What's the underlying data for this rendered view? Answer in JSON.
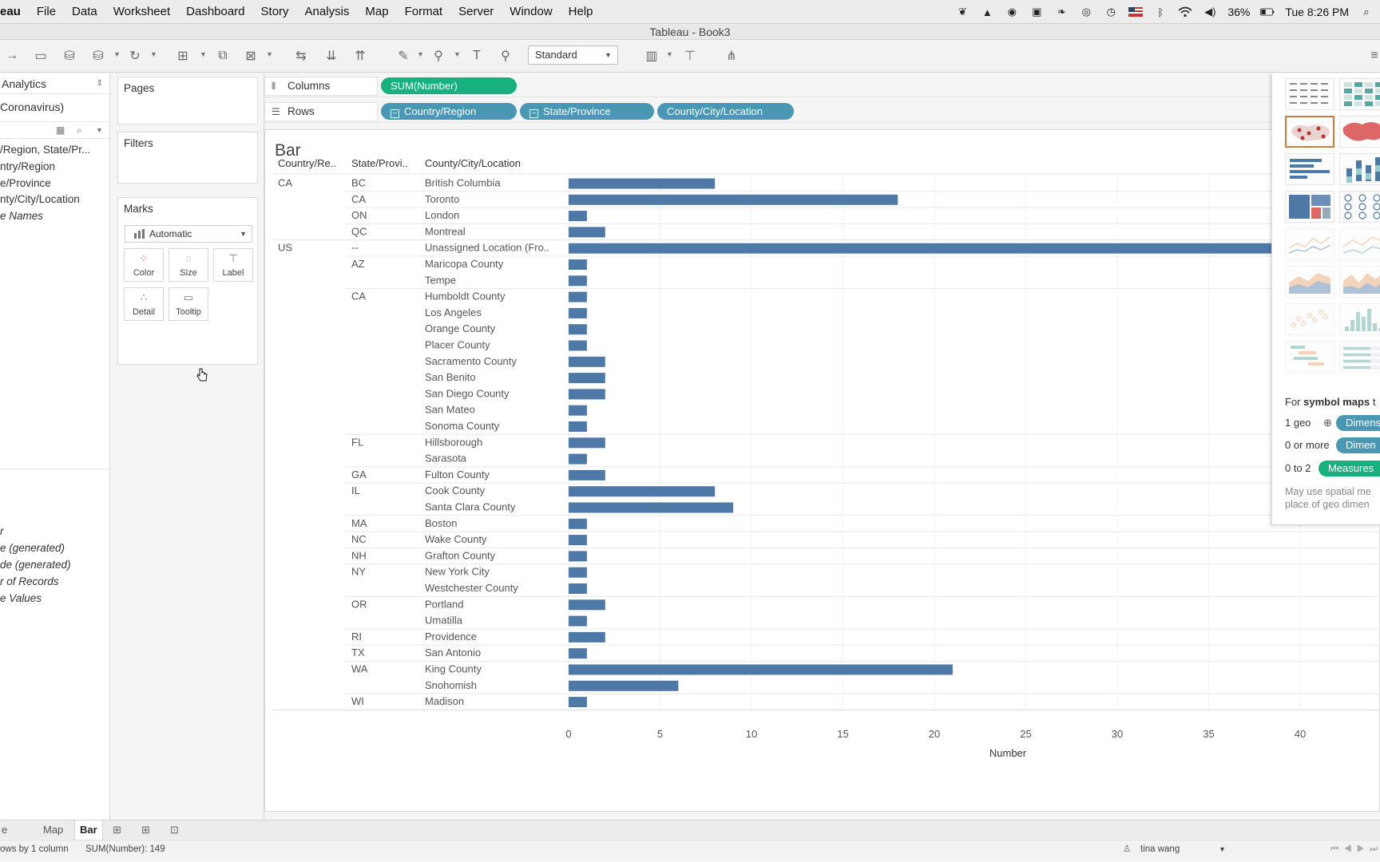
{
  "menubar": {
    "app_name": "eau",
    "items": [
      "File",
      "Data",
      "Worksheet",
      "Dashboard",
      "Story",
      "Analysis",
      "Map",
      "Format",
      "Server",
      "Window",
      "Help"
    ],
    "battery": "36%",
    "clock": "Tue 8:26 PM"
  },
  "window": {
    "title": "Tableau - Book3"
  },
  "toolbar": {
    "fit_label": "Standard"
  },
  "data_pane": {
    "tab_label": "Analytics",
    "datasource": "Coronavirus)",
    "dimensions": [
      {
        "label": "/Region, State/Pr...",
        "italic": false
      },
      {
        "label": "ntry/Region",
        "italic": false
      },
      {
        "label": "e/Province",
        "italic": false
      },
      {
        "label": "nty/City/Location",
        "italic": false
      },
      {
        "label": "e Names",
        "italic": true
      }
    ],
    "measures": [
      {
        "label": "r",
        "italic": true
      },
      {
        "label": "e (generated)",
        "italic": true
      },
      {
        "label": "de (generated)",
        "italic": true
      },
      {
        "label": "r of Records",
        "italic": true
      },
      {
        "label": "e Values",
        "italic": true
      }
    ]
  },
  "cards": {
    "pages": "Pages",
    "filters": "Filters",
    "marks": "Marks",
    "mark_type": "Automatic",
    "buttons": [
      "Color",
      "Size",
      "Label",
      "Detail",
      "Tooltip"
    ]
  },
  "shelves": {
    "columns_label": "Columns",
    "rows_label": "Rows",
    "columns_pills": [
      "SUM(Number)"
    ],
    "rows_pills": [
      "Country/Region",
      "State/Province",
      "County/City/Location"
    ]
  },
  "sheet": {
    "title": "Bar"
  },
  "chart_data": {
    "type": "bar",
    "orientation": "horizontal",
    "headers": [
      "Country/Re..",
      "State/Provi..",
      "County/City/Location"
    ],
    "xlabel": "Number",
    "xlim": [
      0,
      40
    ],
    "xticks": [
      "0",
      "5",
      "10",
      "15",
      "20",
      "25",
      "30",
      "35",
      "40"
    ],
    "color": "#4e79a7",
    "rows": [
      {
        "country": "CA",
        "state": "BC",
        "location": "British Columbia",
        "value": 8
      },
      {
        "country": "",
        "state": "CA",
        "location": "Toronto",
        "value": 18
      },
      {
        "country": "",
        "state": "ON",
        "location": "London",
        "value": 1
      },
      {
        "country": "",
        "state": "QC",
        "location": "Montreal",
        "value": 2
      },
      {
        "country": "US",
        "state": "--",
        "location": "Unassigned Location (Fro..",
        "value": 45
      },
      {
        "country": "",
        "state": "AZ",
        "location": "Maricopa County",
        "value": 1
      },
      {
        "country": "",
        "state": "",
        "location": "Tempe",
        "value": 1
      },
      {
        "country": "",
        "state": "CA",
        "location": "Humboldt County",
        "value": 1
      },
      {
        "country": "",
        "state": "",
        "location": "Los Angeles",
        "value": 1
      },
      {
        "country": "",
        "state": "",
        "location": "Orange County",
        "value": 1
      },
      {
        "country": "",
        "state": "",
        "location": "Placer County",
        "value": 1
      },
      {
        "country": "",
        "state": "",
        "location": "Sacramento County",
        "value": 2
      },
      {
        "country": "",
        "state": "",
        "location": "San Benito",
        "value": 2
      },
      {
        "country": "",
        "state": "",
        "location": "San Diego County",
        "value": 2
      },
      {
        "country": "",
        "state": "",
        "location": "San Mateo",
        "value": 1
      },
      {
        "country": "",
        "state": "",
        "location": "Sonoma County",
        "value": 1
      },
      {
        "country": "",
        "state": "FL",
        "location": "Hillsborough",
        "value": 2
      },
      {
        "country": "",
        "state": "",
        "location": "Sarasota",
        "value": 1
      },
      {
        "country": "",
        "state": "GA",
        "location": "Fulton County",
        "value": 2
      },
      {
        "country": "",
        "state": "IL",
        "location": "Cook County",
        "value": 8
      },
      {
        "country": "",
        "state": "",
        "location": "Santa Clara County",
        "value": 9
      },
      {
        "country": "",
        "state": "MA",
        "location": "Boston",
        "value": 1
      },
      {
        "country": "",
        "state": "NC",
        "location": "Wake County",
        "value": 1
      },
      {
        "country": "",
        "state": "NH",
        "location": "Grafton County",
        "value": 1
      },
      {
        "country": "",
        "state": "NY",
        "location": "New York City",
        "value": 1
      },
      {
        "country": "",
        "state": "",
        "location": "Westchester County",
        "value": 1
      },
      {
        "country": "",
        "state": "OR",
        "location": "Portland",
        "value": 2
      },
      {
        "country": "",
        "state": "",
        "location": "Umatilla",
        "value": 1
      },
      {
        "country": "",
        "state": "RI",
        "location": "Providence",
        "value": 2
      },
      {
        "country": "",
        "state": "TX",
        "location": "San Antonio",
        "value": 1
      },
      {
        "country": "",
        "state": "WA",
        "location": "King County",
        "value": 21
      },
      {
        "country": "",
        "state": "",
        "location": "Snohomish",
        "value": 6
      },
      {
        "country": "",
        "state": "WI",
        "location": "Madison",
        "value": 1
      }
    ]
  },
  "show_me": {
    "hint_prefix": "For ",
    "hint_bold": "symbol maps",
    "hint_suffix": " t",
    "requirements": [
      {
        "count": "1 geo",
        "chip": "Dimens",
        "chip_color": "#4a97b4"
      },
      {
        "count": "0 or more",
        "chip": "Dimen",
        "chip_color": "#4a97b4"
      },
      {
        "count": "0 to 2",
        "chip": "Measures",
        "chip_color": "#18b07f"
      }
    ],
    "note_line1": "May use spatial me",
    "note_line2": "place of geo dimen"
  },
  "tabs": {
    "partial": "e",
    "items": [
      "Map",
      "Bar"
    ],
    "active": "Bar"
  },
  "statusbar": {
    "left": "ows by 1 column",
    "sum": "SUM(Number): 149",
    "user": "tina wang"
  }
}
